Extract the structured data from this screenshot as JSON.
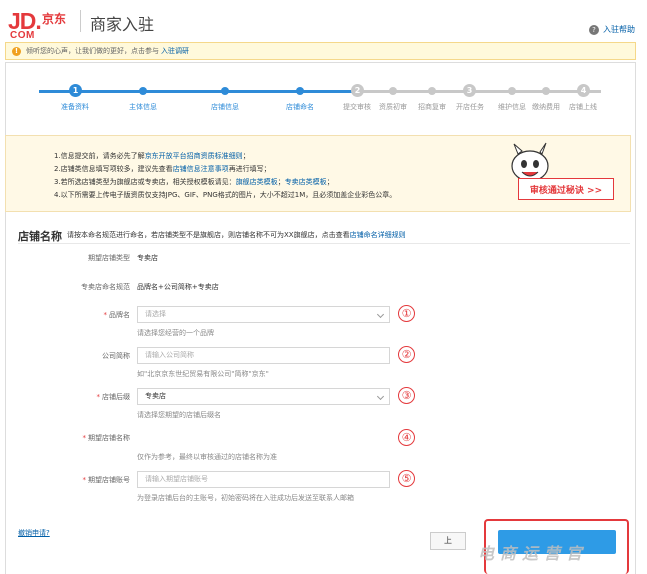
{
  "header": {
    "logo_jd": "JD.",
    "logo_cn": "京东",
    "logo_com": "COM",
    "title": "商家入驻",
    "help_icon": "question-icon",
    "help_label": "入驻帮助"
  },
  "notice": {
    "text": "倾听您的心声，让我们做的更好，点击参与",
    "link": "入驻调研"
  },
  "steps": {
    "active_color": "#2e8bd8",
    "inactive_color": "#c8c8c8",
    "groups": [
      "1",
      "2",
      "3",
      "4"
    ],
    "labels": [
      "准备资料",
      "主体信息",
      "店铺信息",
      "店铺命名",
      "提交审核",
      "资质初审",
      "招商复审",
      "开店任务",
      "维护信息",
      "缴纳费用",
      "店铺上线"
    ]
  },
  "info": {
    "line1_a": "1.信息提交前，请务必先了解",
    "line1_link": "京东开放平台招商资质标准细则",
    "line1_b": "；",
    "line2_a": "2.店铺类信息填写项较多，建议先查看",
    "line2_link": "店铺信息注意事项",
    "line2_b": "再进行填写；",
    "line3_a": "3.若所选店铺类型为旗舰店或专卖店，相关授权模板请见：",
    "line3_link1": "旗舰店类模板",
    "line3_mid": "；",
    "line3_link2": "专卖店类模板",
    "line3_b": "；",
    "line4": "4.以下所需要上传电子版资质仅支持JPG、GIF、PNG格式的图片，大小不超过1M，且必须加盖企业彩色公章。",
    "audit_button": "审核通过秘诀 >>"
  },
  "form": {
    "section_title": "店铺名称",
    "section_desc": "请按本命名规范进行命名，若店铺类型不是旗舰店，则店铺名称不可为XX旗舰店，点击查看",
    "section_link": "店铺命名详细规则",
    "store_type_label": "期望店铺类型",
    "store_type_value": "专卖店",
    "naming_rule_label": "专卖店命名规范",
    "naming_rule_value": "品牌名+公司简称+专卖店",
    "brand_label": "品牌名",
    "brand_placeholder": "请选择",
    "brand_hint": "请选择您经营的一个品牌",
    "brand_num": "①",
    "company_label": "公司简称",
    "company_placeholder": "请输入公司简称",
    "company_hint": "如\"北京京东世纪贸易有限公司\"简称\"京东\"",
    "company_num": "②",
    "suffix_label": "店铺后缀",
    "suffix_value": "专卖店",
    "suffix_hint": "请选择您期望的店铺后缀名",
    "suffix_num": "③",
    "expected_name_label": "期望店铺名称",
    "expected_name_hint": "仅作为参考，最终以审核通过的店铺名称为准",
    "expected_name_num": "④",
    "account_label": "期望店铺账号",
    "account_placeholder": "请输入期望店铺账号",
    "account_hint": "为登录店铺后台的主账号，初始密码将在入驻成功后发送至联系人邮箱",
    "account_num": "⑤",
    "required_mark": "*"
  },
  "footer": {
    "cancel": "撤销申请?",
    "prev": "上",
    "watermark": "电商运营官"
  }
}
